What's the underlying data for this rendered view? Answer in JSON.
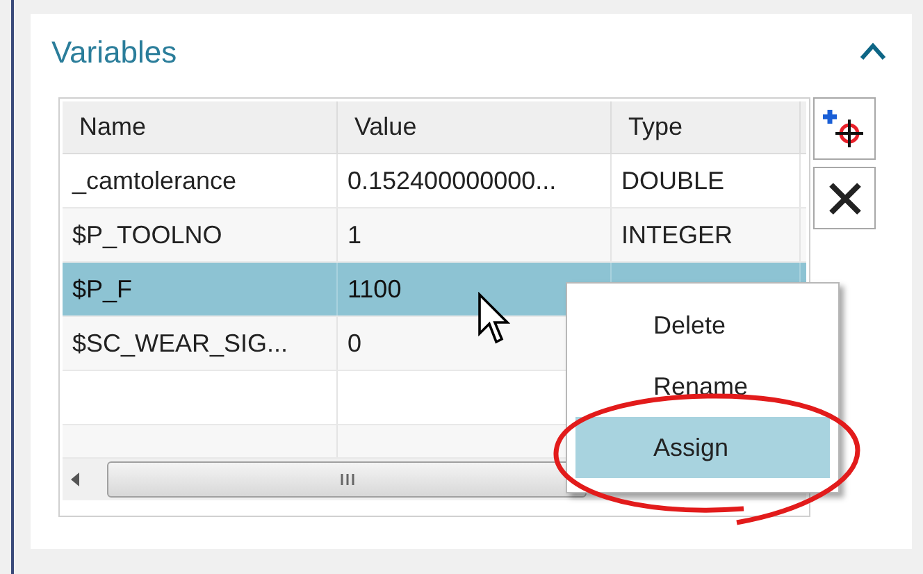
{
  "panel": {
    "title": "Variables",
    "expanded": true
  },
  "table": {
    "columns": [
      "Name",
      "Value",
      "Type"
    ],
    "rows": [
      {
        "name": "_camtolerance",
        "value": "0.152400000000...",
        "type": "DOUBLE",
        "selected": false
      },
      {
        "name": "$P_TOOLNO",
        "value": "1",
        "type": "INTEGER",
        "selected": false
      },
      {
        "name": "$P_F",
        "value": "1100",
        "selected": true
      },
      {
        "name": "$SC_WEAR_SIG...",
        "value": "0",
        "selected": false
      },
      {
        "selected": false
      },
      {
        "selected": false
      }
    ]
  },
  "context_menu": {
    "items": [
      {
        "label": "Delete",
        "selected": false
      },
      {
        "label": "Rename",
        "selected": false
      },
      {
        "label": "Assign",
        "selected": true
      }
    ]
  }
}
